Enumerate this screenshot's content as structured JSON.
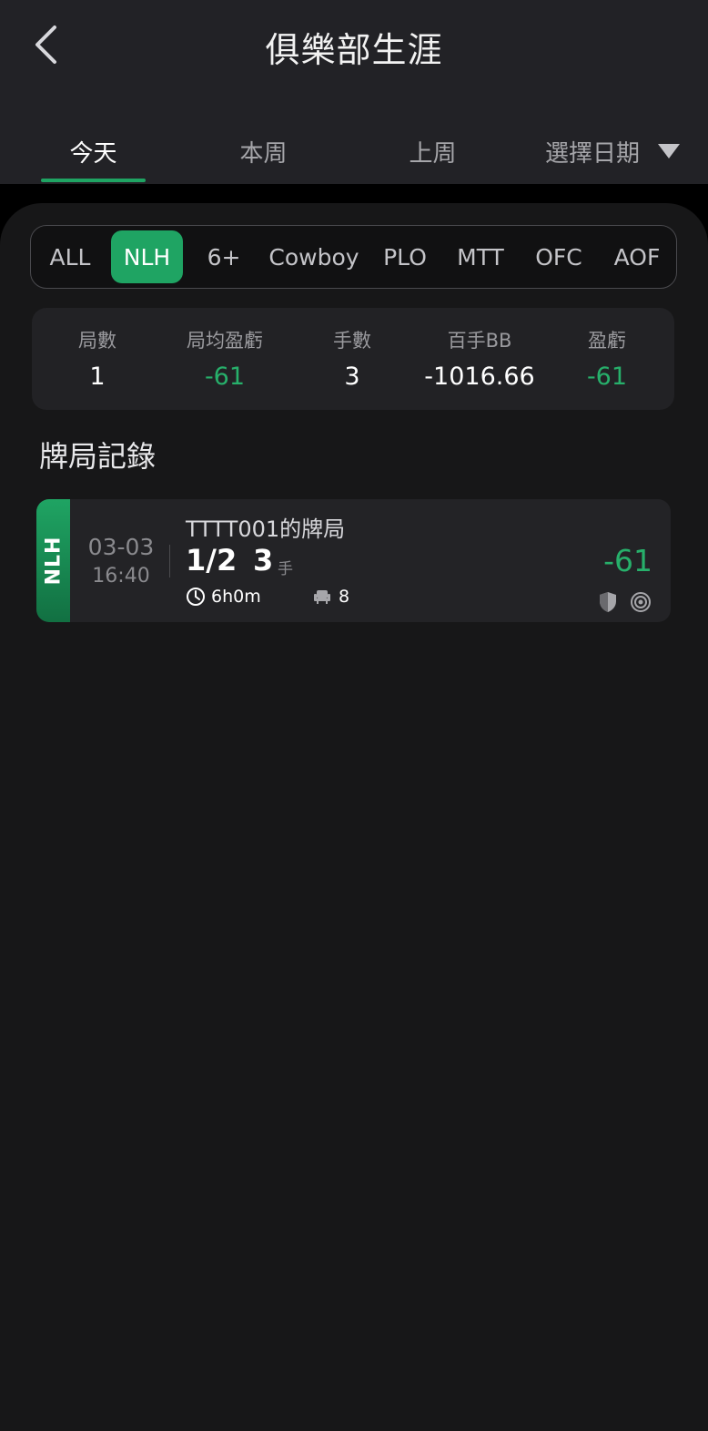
{
  "header": {
    "title": "俱樂部生涯",
    "back_icon": "chevron-left-icon"
  },
  "tabs": [
    {
      "label": "今天",
      "active": true
    },
    {
      "label": "本周",
      "active": false
    },
    {
      "label": "上周",
      "active": false
    },
    {
      "label": "選擇日期",
      "active": false,
      "icon": "triangle-down-icon"
    }
  ],
  "game_filter": [
    {
      "label": "ALL",
      "active": false
    },
    {
      "label": "NLH",
      "active": true
    },
    {
      "label": "6+",
      "active": false
    },
    {
      "label": "Cowboy",
      "active": false
    },
    {
      "label": "PLO",
      "active": false
    },
    {
      "label": "MTT",
      "active": false
    },
    {
      "label": "OFC",
      "active": false
    },
    {
      "label": "AOF",
      "active": false
    }
  ],
  "stats": [
    {
      "label": "局數",
      "value": "1"
    },
    {
      "label": "局均盈虧",
      "value": "-61"
    },
    {
      "label": "手數",
      "value": "3"
    },
    {
      "label": "百手BB",
      "value": "-1016.66"
    },
    {
      "label": "盈虧",
      "value": "-61"
    }
  ],
  "records_section": {
    "title": "牌局記錄"
  },
  "records": [
    {
      "game_type": "NLH",
      "date": "03-03",
      "time": "16:40",
      "name": "TTTT001的牌局",
      "blinds": "1/2",
      "hands": "3",
      "hands_unit": "手",
      "duration": "6h0m",
      "players": "8",
      "profit": "-61",
      "icons": [
        "clock-icon",
        "seat-icon",
        "shield-icon",
        "target-icon"
      ]
    }
  ],
  "colors": {
    "accent": "#1fa463",
    "profit_green": "#27b06b",
    "header_bg": "#222226",
    "content_bg": "#171718"
  }
}
